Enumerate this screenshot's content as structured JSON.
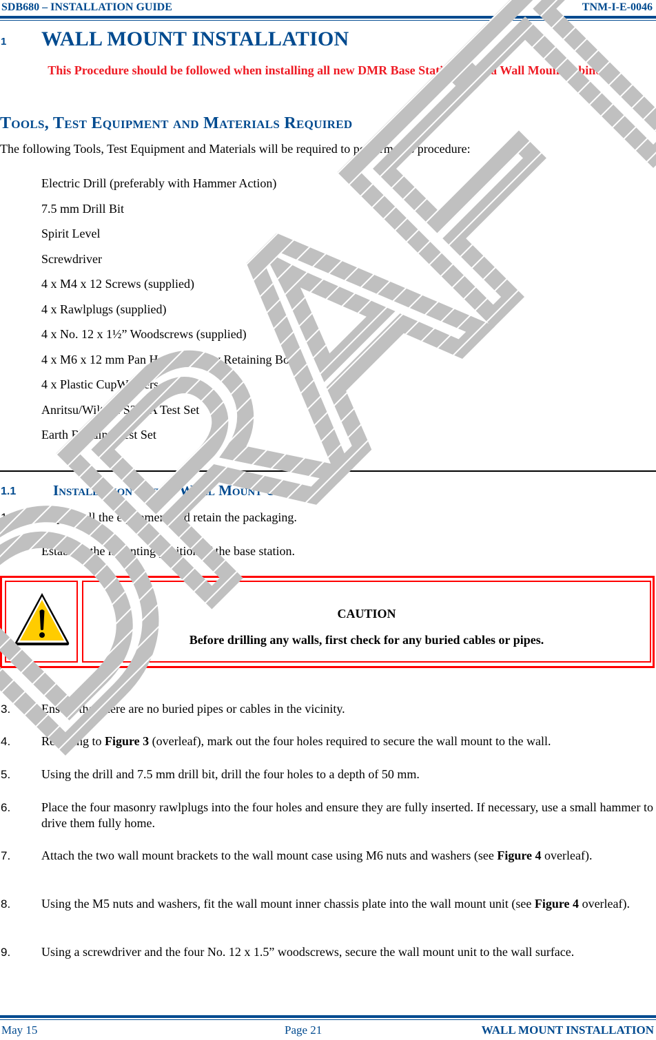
{
  "header": {
    "left": "SDB680 – INSTALLATION GUIDE",
    "right": "TNM-I-E-0046"
  },
  "heading1": {
    "number": "1",
    "title": "WALL MOUNT INSTALLATION"
  },
  "intro_note": "This Procedure should be followed when installing all new DMR Base Stations with a Wall Mount cabinet.",
  "tools_section": {
    "heading": "Tools, Test Equipment and Materials Required",
    "intro": "The following Tools, Test Equipment and Materials will be required to perform this procedure:",
    "items": [
      "Electric Drill (preferably with Hammer Action)",
      "7.5 mm Drill Bit",
      "Spirit Level",
      "Screwdriver",
      "4 x M4 x 12 Screws (supplied)",
      "4 x Rawlplugs (supplied)",
      "4 x No. 12 x 1½” Woodscrews (supplied)",
      "4 x M6 x 12 mm Pan Head Pozidriv Retaining Bolts",
      "4 x Plastic CupWashers",
      "Anritsu/Wiltron S331A Test Set",
      "Earth Bonding Test Set"
    ]
  },
  "section_1_1": {
    "number": "1.1",
    "title": "Installation of the Wall Mount Unit",
    "steps_before_caution": [
      {
        "num": "1.",
        "text": "Unpack all the equipment and retain the packaging."
      },
      {
        "num": "2.",
        "text": "Establish the mounting position of the base station."
      }
    ],
    "caution": {
      "icon": "warning-triangle-icon",
      "title": "CAUTION",
      "message": "Before drilling any walls, first check for any buried cables or pipes."
    },
    "steps_after_caution": [
      {
        "num": "3.",
        "text": "Ensure that there are no buried pipes or cables in the vicinity."
      },
      {
        "num": "4.",
        "pre": "Referring to ",
        "bold": "Figure 3",
        "post": " (overleaf), mark out the four holes required to secure the wall mount to the wall."
      },
      {
        "num": "5.",
        "text": "Using the drill and 7.5 mm drill bit, drill the four holes to a depth of 50 mm."
      },
      {
        "num": "6.",
        "text": "Place the four masonry rawlplugs into the four holes and ensure they are fully inserted.  If necessary, use a small hammer to drive them fully home."
      },
      {
        "num": "7.",
        "pre": "Attach the two wall mount brackets to the wall mount case using M6 nuts and washers (see ",
        "bold": "Figure 4",
        "post": " overleaf)."
      },
      {
        "num": "8.",
        "pre": "Using the M5 nuts and washers, fit the wall mount inner chassis plate into the wall mount unit (see ",
        "bold": "Figure 4",
        "post": " overleaf)."
      },
      {
        "num": "9.",
        "text": "Using a screwdriver and the four No. 12 x 1.5” woodscrews, secure the wall mount unit to the wall surface."
      }
    ]
  },
  "footer": {
    "date": "May 15",
    "page": "Page 21",
    "section": "WALL MOUNT INSTALLATION"
  },
  "watermark": {
    "text": "DRAFT",
    "color": "#c0c0c0"
  },
  "colors": {
    "brand_blue": "#004a8f",
    "alert_red": "#ee1c25",
    "caution_border": "#ff0000",
    "warning_yellow": "#ffcc00"
  }
}
